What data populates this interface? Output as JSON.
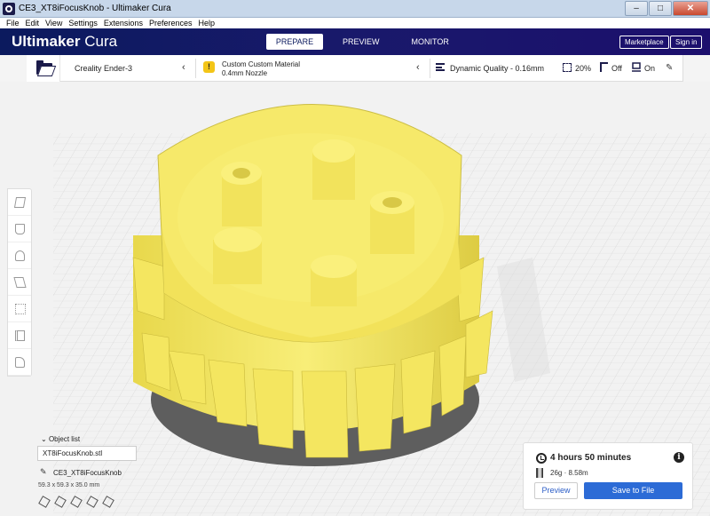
{
  "window": {
    "title": "CE3_XT8iFocusKnob - Ultimaker Cura",
    "minimize": "–",
    "maximize": "□",
    "close": "✕"
  },
  "menu": {
    "file": "File",
    "edit": "Edit",
    "view": "View",
    "settings": "Settings",
    "extensions": "Extensions",
    "preferences": "Preferences",
    "help": "Help"
  },
  "header": {
    "logo_brand": "Ultimaker",
    "logo_product": "Cura",
    "tabs": [
      "PREPARE",
      "PREVIEW",
      "MONITOR"
    ],
    "active_tab": "PREPARE",
    "marketplace": "Marketplace",
    "signin": "Sign in"
  },
  "config": {
    "printer": "Creality Ender-3",
    "material": "Custom Custom Material",
    "nozzle": "0.4mm Nozzle",
    "quality": "Dynamic Quality - 0.16mm",
    "infill": "20%",
    "support": "Off",
    "adhesion": "On"
  },
  "objects": {
    "label": "Object list",
    "field_value": "XT8iFocusKnob.stl",
    "object_name": "CE3_XT8iFocusKnob",
    "dimensions": "59.3 x 59.3 x 35.0 mm"
  },
  "action": {
    "print_time": "4 hours 50 minutes",
    "material_estimate": "26g · 8.58m",
    "preview": "Preview",
    "save": "Save to File"
  },
  "colors": {
    "header": "#0b1a5e",
    "model_yellow": "#f7eb63",
    "accent_blue": "#2c6bd6"
  }
}
